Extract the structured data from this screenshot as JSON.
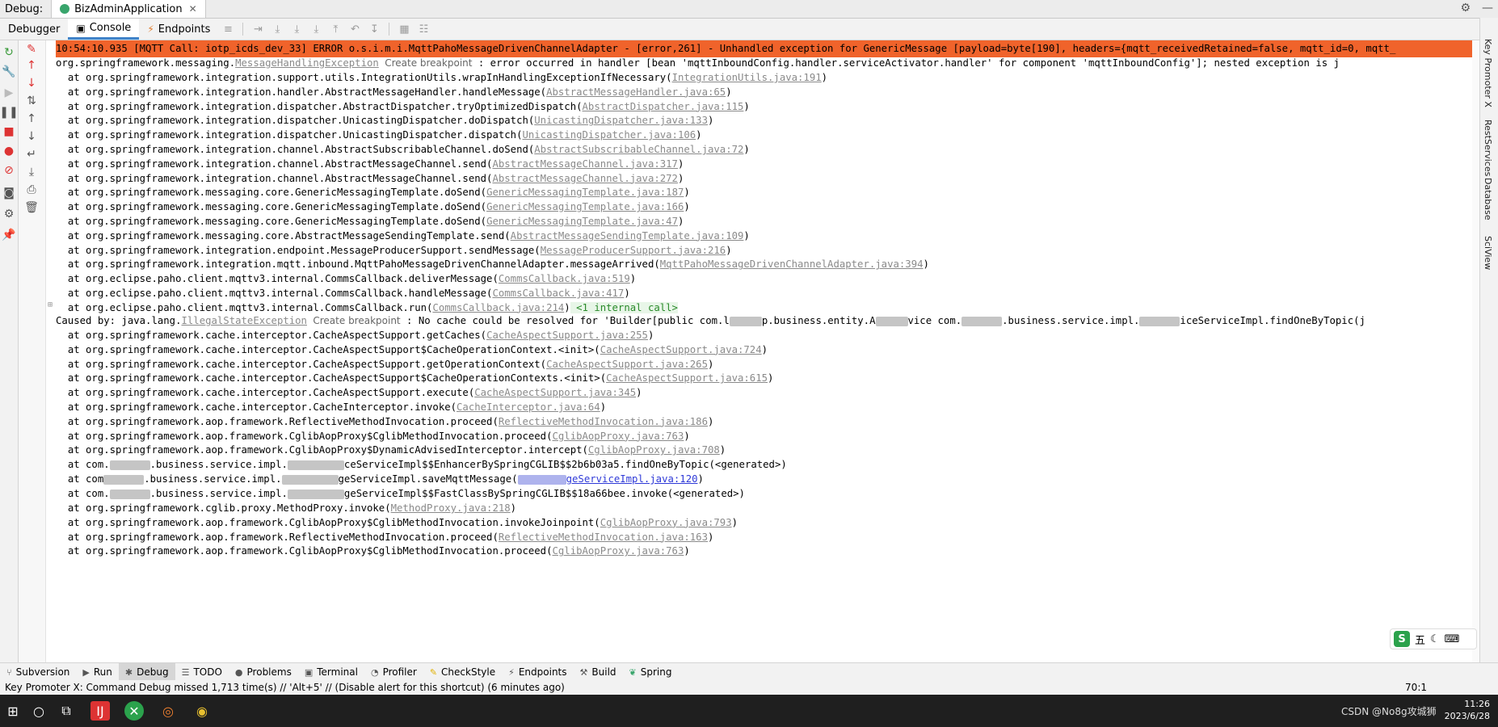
{
  "window": {
    "debug_label": "Debug:",
    "run_tab": "BizAdminApplication",
    "tabs": [
      "Debugger",
      "Console",
      "Endpoints"
    ]
  },
  "console": {
    "error_line": "10:54:10.935 [MQTT Call: iotp_icds_dev_33] ERROR o.s.i.m.i.MqttPahoMessageDrivenChannelAdapter - [error,261] - Unhandled exception for GenericMessage [payload=byte[190], headers={mqtt_receivedRetained=false, mqtt_id=0, mqtt_",
    "exc1_prefix": "org.springframework.messaging.",
    "exc1_name": "MessageHandlingException",
    "create_breakpoint": "Create breakpoint",
    "exc1_msg": " : error occurred in handler [bean 'mqttInboundConfig.handler.serviceActivator.handler' for component 'mqttInboundConfig']; nested exception is j",
    "frames1": [
      {
        "t": "at org.springframework.integration.support.utils.IntegrationUtils.wrapInHandlingExceptionIfNecessary(",
        "l": "IntegrationUtils.java:191"
      },
      {
        "t": "at org.springframework.integration.handler.AbstractMessageHandler.handleMessage(",
        "l": "AbstractMessageHandler.java:65"
      },
      {
        "t": "at org.springframework.integration.dispatcher.AbstractDispatcher.tryOptimizedDispatch(",
        "l": "AbstractDispatcher.java:115"
      },
      {
        "t": "at org.springframework.integration.dispatcher.UnicastingDispatcher.doDispatch(",
        "l": "UnicastingDispatcher.java:133"
      },
      {
        "t": "at org.springframework.integration.dispatcher.UnicastingDispatcher.dispatch(",
        "l": "UnicastingDispatcher.java:106"
      },
      {
        "t": "at org.springframework.integration.channel.AbstractSubscribableChannel.doSend(",
        "l": "AbstractSubscribableChannel.java:72"
      },
      {
        "t": "at org.springframework.integration.channel.AbstractMessageChannel.send(",
        "l": "AbstractMessageChannel.java:317"
      },
      {
        "t": "at org.springframework.integration.channel.AbstractMessageChannel.send(",
        "l": "AbstractMessageChannel.java:272"
      },
      {
        "t": "at org.springframework.messaging.core.GenericMessagingTemplate.doSend(",
        "l": "GenericMessagingTemplate.java:187"
      },
      {
        "t": "at org.springframework.messaging.core.GenericMessagingTemplate.doSend(",
        "l": "GenericMessagingTemplate.java:166"
      },
      {
        "t": "at org.springframework.messaging.core.GenericMessagingTemplate.doSend(",
        "l": "GenericMessagingTemplate.java:47"
      },
      {
        "t": "at org.springframework.messaging.core.AbstractMessageSendingTemplate.send(",
        "l": "AbstractMessageSendingTemplate.java:109"
      },
      {
        "t": "at org.springframework.integration.endpoint.MessageProducerSupport.sendMessage(",
        "l": "MessageProducerSupport.java:216"
      },
      {
        "t": "at org.springframework.integration.mqtt.inbound.MqttPahoMessageDrivenChannelAdapter.messageArrived(",
        "l": "MqttPahoMessageDrivenChannelAdapter.java:394"
      },
      {
        "t": "at org.eclipse.paho.client.mqttv3.internal.CommsCallback.deliverMessage(",
        "l": "CommsCallback.java:519"
      },
      {
        "t": "at org.eclipse.paho.client.mqttv3.internal.CommsCallback.handleMessage(",
        "l": "CommsCallback.java:417"
      },
      {
        "t": "at org.eclipse.paho.client.mqttv3.internal.CommsCallback.run(",
        "l": "CommsCallback.java:214",
        "extra": " <1 internal call>"
      }
    ],
    "caused_prefix": "Caused by: java.lang.",
    "caused_name": "IllegalStateException",
    "caused_msg_a": " : No cache could be resolved for 'Builder[public com.l",
    "caused_msg_b": "p.business.entity.A",
    "caused_msg_c": "vice com.",
    "caused_msg_d": ".business.service.impl.",
    "caused_msg_e": "iceServiceImpl.findOneByTopic(j",
    "frames2": [
      {
        "t": "at org.springframework.cache.interceptor.CacheAspectSupport.getCaches(",
        "l": "CacheAspectSupport.java:255"
      },
      {
        "t": "at org.springframework.cache.interceptor.CacheAspectSupport$CacheOperationContext.<init>(",
        "l": "CacheAspectSupport.java:724"
      },
      {
        "t": "at org.springframework.cache.interceptor.CacheAspectSupport.getOperationContext(",
        "l": "CacheAspectSupport.java:265"
      },
      {
        "t": "at org.springframework.cache.interceptor.CacheAspectSupport$CacheOperationContexts.<init>(",
        "l": "CacheAspectSupport.java:615"
      },
      {
        "t": "at org.springframework.cache.interceptor.CacheAspectSupport.execute(",
        "l": "CacheAspectSupport.java:345"
      },
      {
        "t": "at org.springframework.cache.interceptor.CacheInterceptor.invoke(",
        "l": "CacheInterceptor.java:64"
      },
      {
        "t": "at org.springframework.aop.framework.ReflectiveMethodInvocation.proceed(",
        "l": "ReflectiveMethodInvocation.java:186"
      },
      {
        "t": "at org.springframework.aop.framework.CglibAopProxy$CglibMethodInvocation.proceed(",
        "l": "CglibAopProxy.java:763"
      },
      {
        "t": "at org.springframework.aop.framework.CglibAopProxy$DynamicAdvisedInterceptor.intercept(",
        "l": "CglibAopProxy.java:708"
      }
    ],
    "blur1_a": "at com.",
    "blur1_b": ".business.service.impl.",
    "blur1_c": "ceServiceImpl$$EnhancerBySpringCGLIB$$2b6b03a5.findOneByTopic(<generated>)",
    "blur2_a": "at com",
    "blur2_b": ".business.service.impl.",
    "blur2_c": "geServiceImpl.saveMqttMessage(",
    "blur2_link": "geServiceImpl.java:120",
    "blur3_a": "at com.",
    "blur3_b": ".business.service.impl.",
    "blur3_c": "geServiceImpl$$FastClassBySpringCGLIB$$18a66bee.invoke(<generated>)",
    "frames3": [
      {
        "t": "at org.springframework.cglib.proxy.MethodProxy.invoke(",
        "l": "MethodProxy.java:218"
      },
      {
        "t": "at org.springframework.aop.framework.CglibAopProxy$CglibMethodInvocation.invokeJoinpoint(",
        "l": "CglibAopProxy.java:793"
      },
      {
        "t": "at org.springframework.aop.framework.ReflectiveMethodInvocation.proceed(",
        "l": "ReflectiveMethodInvocation.java:163"
      },
      {
        "t": "at org.springframework.aop.framework.CglibAopProxy$CglibMethodInvocation.proceed(",
        "l": "CglibAopProxy.java:763"
      }
    ]
  },
  "right_tools": [
    "Key Promoter X",
    "RestServices",
    "Database",
    "SciView"
  ],
  "bottom_tabs": [
    "Subversion",
    "Run",
    "Debug",
    "TODO",
    "Problems",
    "Terminal",
    "Profiler",
    "CheckStyle",
    "Endpoints",
    "Build",
    "Spring"
  ],
  "status": {
    "message": "Key Promoter X: Command Debug missed 1,713 time(s) // 'Alt+5' // (Disable alert for this shortcut) (6 minutes ago)",
    "position": "70:1"
  },
  "ime": {
    "logo": "S",
    "char": "五"
  },
  "tray": {
    "time": "11:26",
    "date": "2023/6/28",
    "watermark": "CSDN @No8g攻城狮"
  },
  "colors": {
    "error_bg": "#f0632b",
    "link": "#8a8a8a",
    "active_tab": "#4083c9"
  }
}
